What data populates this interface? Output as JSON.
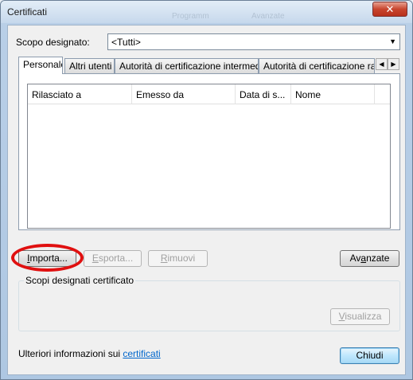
{
  "window": {
    "title": "Certificati",
    "close_glyph": "✕",
    "background_ghost_text": [
      "Programm",
      "Avanzate"
    ]
  },
  "purpose": {
    "label_pre": "Scopo desi",
    "label_accel": "g",
    "label_post": "nato:",
    "selected": "<Tutti>"
  },
  "tabs": [
    {
      "label": "Personale",
      "active": true
    },
    {
      "label": "Altri utenti",
      "active": false
    },
    {
      "label": "Autorità di certificazione intermedie",
      "active": false
    },
    {
      "label": "Autorità di certificazione radi",
      "active": false
    }
  ],
  "tab_scroll": {
    "left": "◀",
    "right": "▶"
  },
  "list": {
    "columns": [
      "Rilasciato a",
      "Emesso da",
      "Data di s...",
      "Nome"
    ],
    "rows": []
  },
  "buttons": {
    "import": {
      "accel": "I",
      "rest": "mporta..."
    },
    "export": {
      "accel": "E",
      "rest": "sporta..."
    },
    "remove": {
      "accel": "R",
      "rest": "imuovi"
    },
    "advanced": {
      "pre": "Av",
      "accel": "a",
      "rest": "nzate"
    },
    "view": {
      "accel": "V",
      "rest": "isualizza"
    },
    "close": "Chiudi"
  },
  "group": {
    "legend": "Scopi designati certificato"
  },
  "footer": {
    "text": "Ulteriori informazioni sui ",
    "link": "certificati"
  },
  "colors": {
    "accent": "#0066cc",
    "highlight_ring": "#e01010"
  },
  "icons": {
    "combo_arrow": "chevron-down-icon"
  }
}
